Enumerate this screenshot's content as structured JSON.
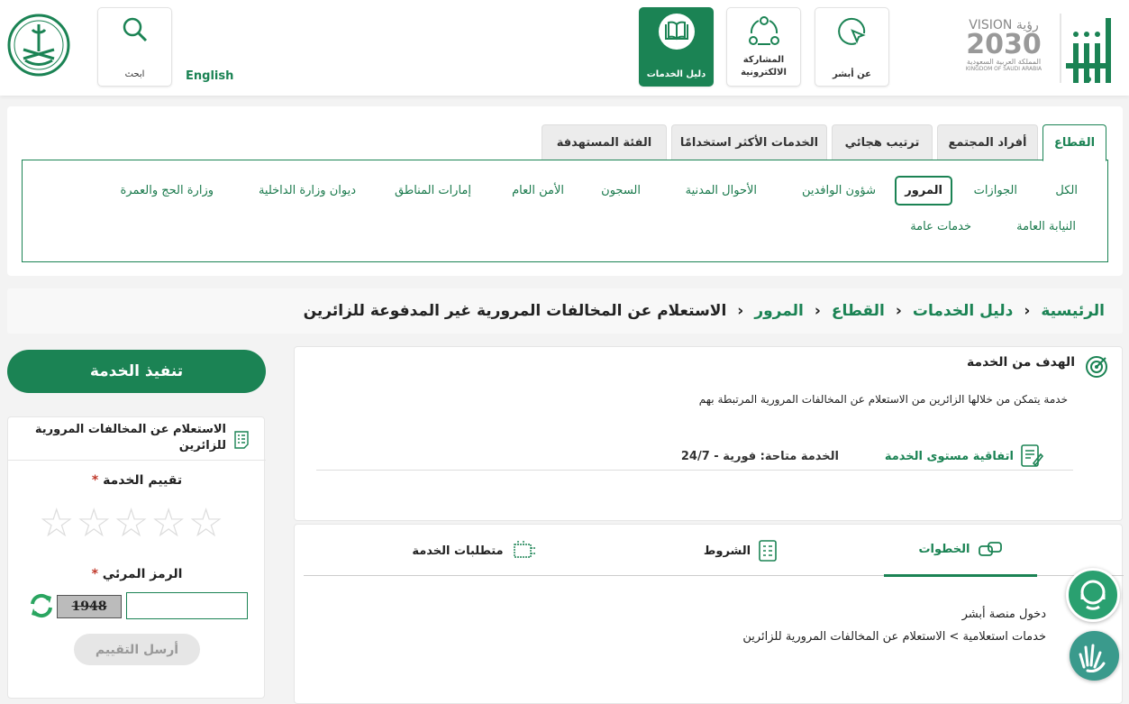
{
  "header": {
    "logo": "أبشر",
    "vision_logo": {
      "line1": "VISION رؤية",
      "line2": "2030",
      "line3": "المملكة العربية السعودية",
      "line4": "KINGDOM OF SAUDI ARABIA"
    },
    "nav": [
      {
        "label": "عن أبشر",
        "icon": "cursor-circle-icon"
      },
      {
        "label": "المشاركة الالكترونية",
        "icon": "share-network-icon"
      },
      {
        "label": "دليل الخدمات",
        "icon": "book-icon",
        "active": true
      }
    ],
    "language": "English",
    "search": {
      "label": "ابحث",
      "icon": "search-icon"
    },
    "emblem": "saudi-emblem"
  },
  "tabs": [
    {
      "label": "القطاع",
      "active": true
    },
    {
      "label": "أفراد المجتمع"
    },
    {
      "label": "ترتيب هجائي"
    },
    {
      "label": "الخدمات الأكثر استخدامًا"
    },
    {
      "label": "الفئة المستهدفة"
    }
  ],
  "sectors": [
    {
      "label": "الكل"
    },
    {
      "label": "الجوازات"
    },
    {
      "label": "المرور",
      "active": true
    },
    {
      "label": "شؤون الوافدين"
    },
    {
      "label": "الأحوال المدنية"
    },
    {
      "label": "السجون"
    },
    {
      "label": "الأمن العام"
    },
    {
      "label": "إمارات المناطق"
    },
    {
      "label": "ديوان وزارة الداخلية"
    },
    {
      "label": "وزارة الحج والعمرة"
    },
    {
      "label": "النيابة العامة"
    },
    {
      "label": "خدمات عامة"
    }
  ],
  "breadcrumb": [
    "الرئيسية",
    "دليل الخدمات",
    "القطاع",
    "المرور",
    "الاستعلام عن المخالفات المرورية غير المدفوعة للزائرين"
  ],
  "goal": {
    "title": "الهدف من الخدمة",
    "text": "خدمة يتمكن من خلالها الزائرين من الاستعلام عن المخالفات المرورية المرتبطة بهم",
    "sla_label": "اتفاقية مستوى الخدمة",
    "sla_value": "الخدمة متاحة: فورية - 24/7"
  },
  "detail_tabs": [
    {
      "label": "الخطوات",
      "icon": "steps-icon",
      "active": true
    },
    {
      "label": "الشروط",
      "icon": "checklist-icon"
    },
    {
      "label": "متطلبات الخدمة",
      "icon": "requirements-icon"
    }
  ],
  "steps": [
    "دخول منصة أبشر",
    "خدمات استعلامية > الاستعلام عن المخالفات المرورية للزائرين"
  ],
  "execute_button": "تنفيذ الخدمة",
  "rating": {
    "title": "الاستعلام عن المخالفات المرورية للزائرين",
    "rating_label": "تقييم الخدمة",
    "required": "*",
    "stars": 0,
    "max_stars": 5,
    "captcha_label": "الرمز المرئي",
    "captcha_code": "1948",
    "captcha_value": "",
    "submit": "أرسل التقييم"
  },
  "colors": {
    "primary": "#1b8354",
    "accent_red": "#c0392b"
  }
}
